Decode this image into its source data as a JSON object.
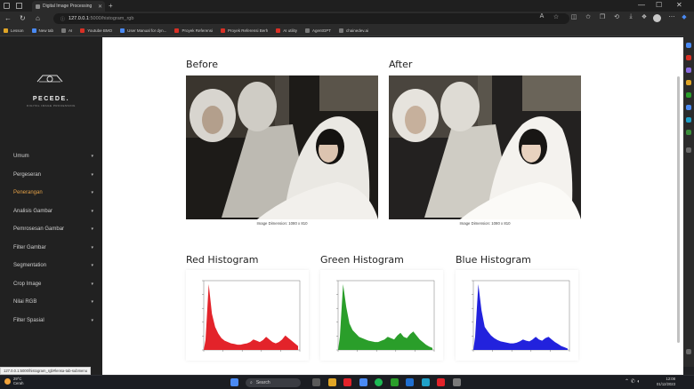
{
  "browser": {
    "tab_title": "Digital Image Processing",
    "url_host": "127.0.0.1",
    "url_path": ":5000/histogram_rgb",
    "status_url": "127.0.0.1:5000/histogram_rgb#lensa-tab-submenu",
    "bookmarks": [
      {
        "label": "Lesson",
        "color": "#e0a526"
      },
      {
        "label": "New tab",
        "color": "#4a8af4"
      },
      {
        "label": "AI",
        "color": "#7a7a7a"
      },
      {
        "label": "Youtube BMO",
        "color": "#d93025"
      },
      {
        "label": "User Manual for dyn...",
        "color": "#4a8af4"
      },
      {
        "label": "Proyek Referensi",
        "color": "#d93025"
      },
      {
        "label": "Proyek Referensi Berh",
        "color": "#d93025"
      },
      {
        "label": "AI utility",
        "color": "#d93025"
      },
      {
        "label": "AgentGPT",
        "color": "#7a7a7a"
      },
      {
        "label": "chainedev.ai",
        "color": "#7a7a7a"
      }
    ]
  },
  "sidebar": {
    "logo_text": "PECEDE.",
    "logo_sub": "DIGITAL IMAGE PROCESSING",
    "items": [
      {
        "label": "Umum",
        "active": false
      },
      {
        "label": "Pergeseran",
        "active": false
      },
      {
        "label": "Penerangan",
        "active": true
      },
      {
        "label": "Analisis Gambar",
        "active": false
      },
      {
        "label": "Pemrosesan Gambar",
        "active": false
      },
      {
        "label": "Filter Gambar",
        "active": false
      },
      {
        "label": "Segmentation",
        "active": false
      },
      {
        "label": "Crop Image",
        "active": false
      },
      {
        "label": "Nilai RGB",
        "active": false
      },
      {
        "label": "Filter Spasial",
        "active": false
      }
    ]
  },
  "main": {
    "before_title": "Before",
    "after_title": "After",
    "before_caption": "Image Dimension: 1080 x 810",
    "after_caption": "Image Dimension: 1080 x 810",
    "red_title": "Red Histogram",
    "green_title": "Green Histogram",
    "blue_title": "Blue Histogram"
  },
  "histograms": [
    {
      "id": "red",
      "color": "#e3232a"
    },
    {
      "id": "green",
      "color": "#2a9e2a"
    },
    {
      "id": "blue",
      "color": "#2222dd"
    }
  ],
  "taskbar": {
    "weather_temp": "29°C",
    "weather_desc": "Cerah",
    "search_label": "Search",
    "time": "12:08",
    "date": "01/12/2023"
  },
  "colors": {
    "accent": "#e2a047",
    "sidebar_bg": "#212121"
  }
}
